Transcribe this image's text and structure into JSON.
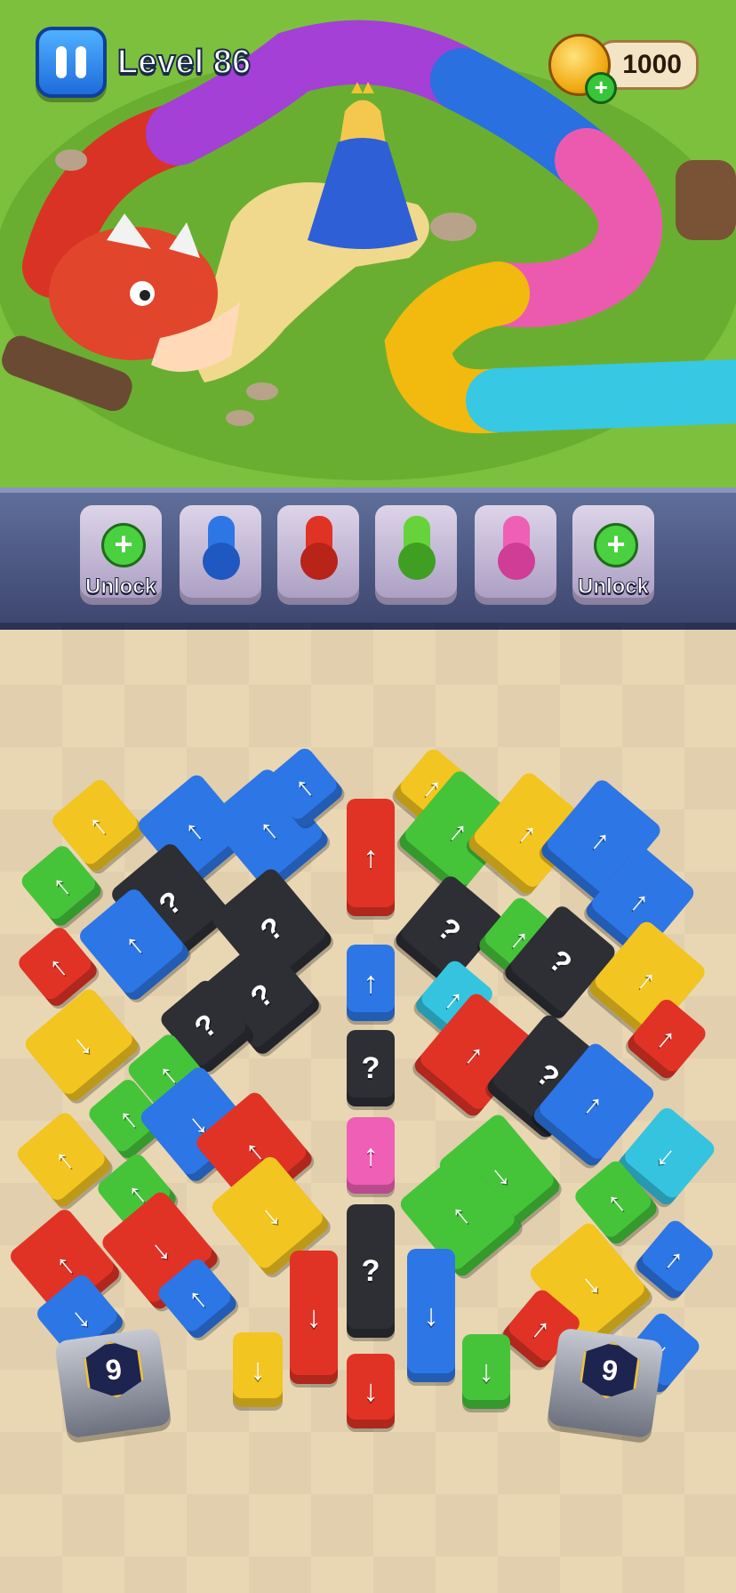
{
  "hud": {
    "level": "Level 86",
    "coins": "1000",
    "add_coins_icon": "plus-icon",
    "pause_icon": "pause-icon"
  },
  "colors": {
    "red": "#e03326",
    "blue": "#2d76e6",
    "green": "#45c43a",
    "yellow": "#f3c520",
    "pink": "#ef5fb6",
    "cyan": "#34c4df",
    "black": "#2d2f35"
  },
  "scene": {
    "characters": [
      "dragon",
      "princess"
    ],
    "dragon_segments": [
      "red",
      "purple",
      "blue",
      "pink",
      "yellow",
      "cyan"
    ]
  },
  "tray": {
    "slots": [
      {
        "type": "locked",
        "label": "Unlock"
      },
      {
        "type": "cannon",
        "color": "blue"
      },
      {
        "type": "cannon",
        "color": "red"
      },
      {
        "type": "cannon",
        "color": "green"
      },
      {
        "type": "cannon",
        "color": "pink"
      },
      {
        "type": "locked",
        "label": "Unlock"
      }
    ]
  },
  "board": {
    "center_column": [
      {
        "color": "red",
        "icon": "↑"
      },
      {
        "color": "blue",
        "icon": "↑"
      },
      {
        "color": "black",
        "icon": "?"
      },
      {
        "color": "pink",
        "icon": "↑"
      },
      {
        "color": "black",
        "icon": "?"
      },
      {
        "color": "red",
        "icon": "↓"
      }
    ],
    "tunnels": [
      {
        "count": "9"
      },
      {
        "count": "9"
      }
    ]
  }
}
